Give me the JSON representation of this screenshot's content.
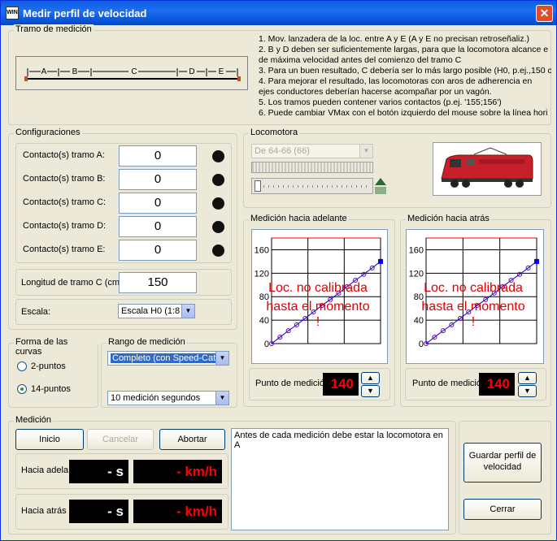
{
  "window": {
    "title": "Medir perfil de velocidad",
    "icon_text": "WIN"
  },
  "tramo": {
    "label": "Tramo de medición",
    "segments": [
      "A",
      "B",
      "C",
      "D",
      "E"
    ],
    "instructions": [
      "1. Mov. lanzadera de la loc. entre A y E (A y E no precisan retroseñaliz.)",
      "2. B y D deben ser suficientemente largas, para que la locomotora alcance e",
      "    de máxima velocidad antes del comienzo del tramo C",
      "3. Para un buen resultado, C debería ser lo más largo posible (H0, p.ej.,150 c",
      "4. Para mejorar el resultado, las locomotoras con aros  de  adherencia en",
      "    ejes conductores deberían hacerse acompañar por un vagón.",
      "5. Los tramos pueden contener varios contactos (p.ej. '155;156')",
      "6. Puede cambiar VMax con el botón izquierdo del mouse sobre la línea hori"
    ]
  },
  "config": {
    "label": "Configuraciones",
    "contacts": [
      {
        "label": "Contacto(s) tramo A:",
        "value": "0"
      },
      {
        "label": "Contacto(s) tramo B:",
        "value": "0"
      },
      {
        "label": "Contacto(s) tramo C:",
        "value": "0"
      },
      {
        "label": "Contacto(s) tramo D:",
        "value": "0"
      },
      {
        "label": "Contacto(s) tramo E:",
        "value": "0"
      }
    ],
    "longitud_label": "Longitud de tramo C (cm)",
    "longitud_value": "150",
    "escala_label": "Escala:",
    "escala_value": "Escala H0 (1:8"
  },
  "locomotora": {
    "label": "Locomotora",
    "selected": "De 64-66 (66)"
  },
  "forma": {
    "label": "Forma de las curvas",
    "options": [
      "2-puntos",
      "14-puntos"
    ],
    "selected": "14-puntos"
  },
  "rango": {
    "label": "Rango de medición",
    "selected": "Completo (con Speed-Cat)",
    "duracion": "10 medición segundos"
  },
  "adelante": {
    "label": "Medición hacia adelante",
    "overlay": [
      "Loc. no calibrada",
      "hasta el momento",
      "!"
    ],
    "punto_label": "Punto de medició",
    "punto_value": "140"
  },
  "atras": {
    "label": "Medición hacia atrás",
    "overlay": [
      "Loc. no calibrada",
      "hasta el momento",
      "!"
    ],
    "punto_label": "Punto de medició",
    "punto_value": "140"
  },
  "medicion": {
    "label": "Medición",
    "btn_inicio": "Inicio",
    "btn_cancelar": "Cancelar",
    "btn_abortar": "Abortar",
    "adelante_label": "Hacia adela",
    "atras_label": "Hacia atrás",
    "time_value": "-  s",
    "speed_value": "-  km/h",
    "log": "Antes de cada medición debe estar la locomotora en A"
  },
  "buttons": {
    "guardar": "Guardar perfil de velocidad",
    "cerrar": "Cerrar"
  },
  "chart_data": [
    {
      "type": "line",
      "title": "Medición hacia adelante",
      "yticks": [
        0,
        40,
        80,
        120,
        160
      ],
      "ylim": [
        0,
        180
      ],
      "x": [
        1,
        2,
        3,
        4,
        5,
        6,
        7,
        8,
        9,
        10,
        11,
        12,
        13,
        14
      ],
      "series": [
        {
          "values": [
            0,
            11,
            22,
            32,
            43,
            54,
            65,
            75,
            86,
            97,
            108,
            118,
            129,
            140
          ]
        }
      ]
    },
    {
      "type": "line",
      "title": "Medición hacia atrás",
      "yticks": [
        0,
        40,
        80,
        120,
        160
      ],
      "ylim": [
        0,
        180
      ],
      "x": [
        1,
        2,
        3,
        4,
        5,
        6,
        7,
        8,
        9,
        10,
        11,
        12,
        13,
        14
      ],
      "series": [
        {
          "values": [
            0,
            11,
            22,
            32,
            43,
            54,
            65,
            75,
            86,
            97,
            108,
            118,
            129,
            140
          ]
        }
      ]
    }
  ]
}
